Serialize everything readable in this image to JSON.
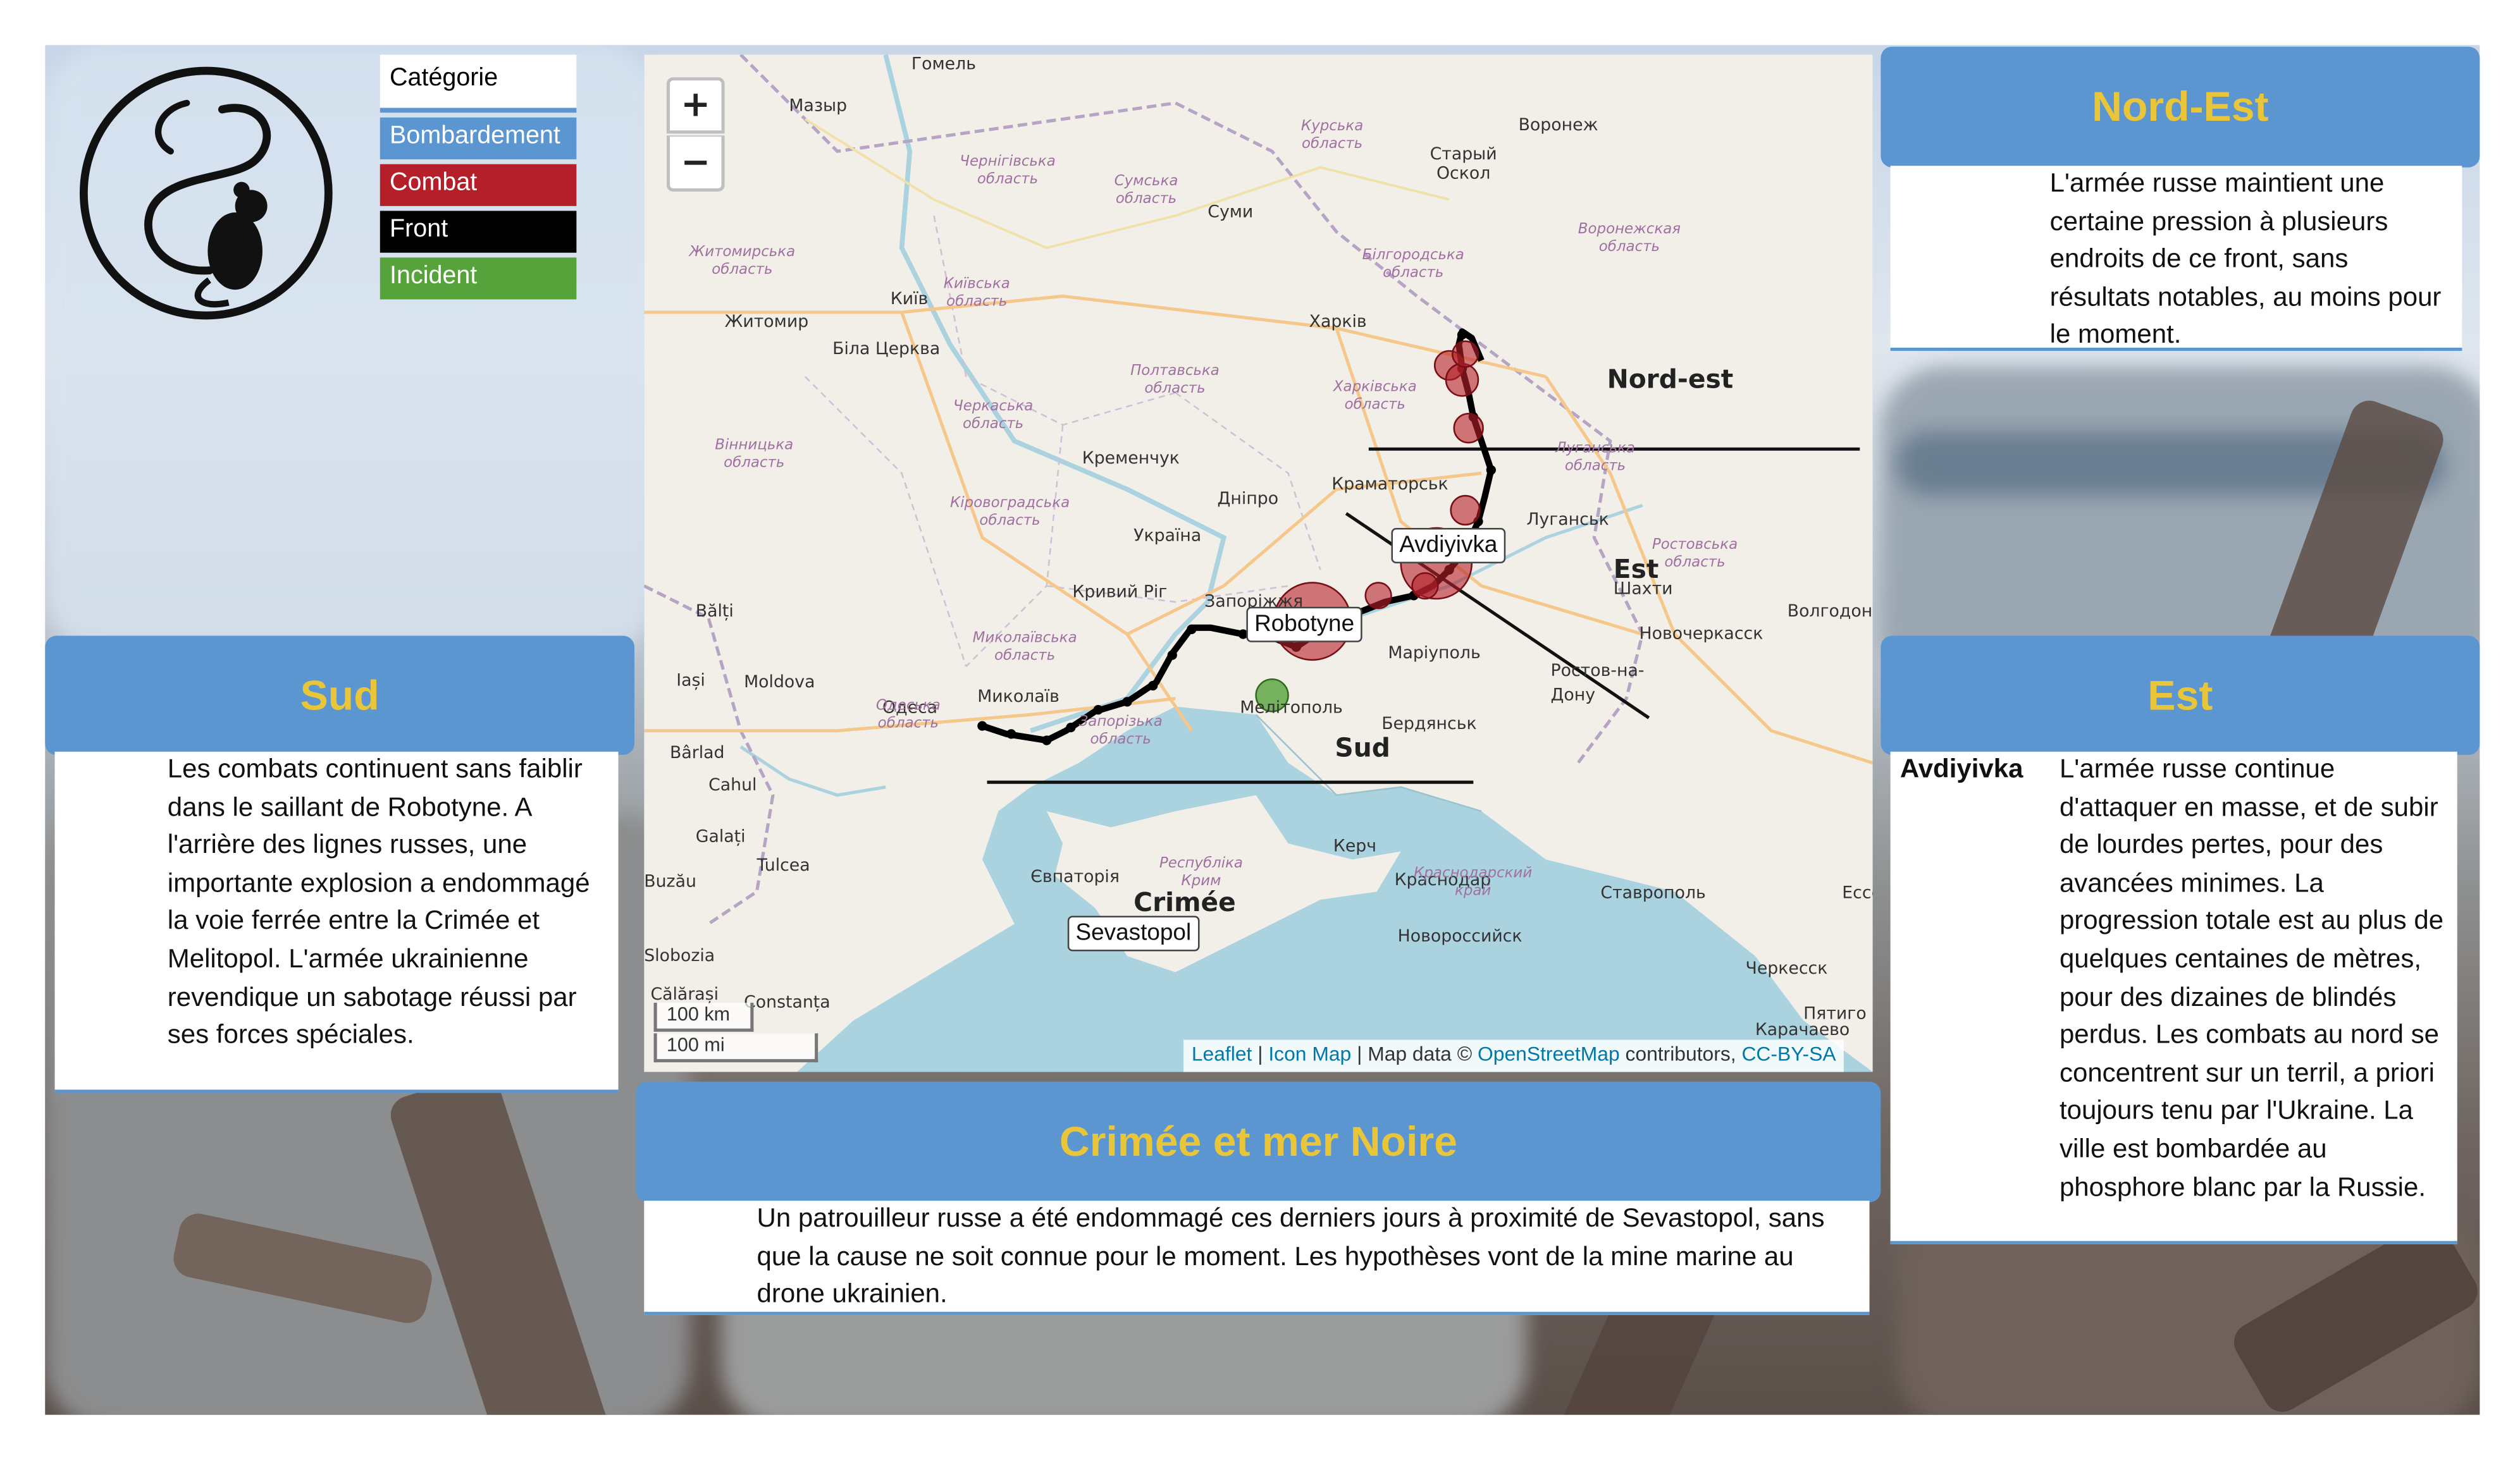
{
  "legend": {
    "title": "Catégorie",
    "items": [
      {
        "label": "Bombardement",
        "color": "#5b96d0"
      },
      {
        "label": "Combat",
        "color": "#b51f2a"
      },
      {
        "label": "Front",
        "color": "#000000"
      },
      {
        "label": "Incident",
        "color": "#56a33b"
      }
    ]
  },
  "map": {
    "zoom_in": "+",
    "zoom_out": "−",
    "markers": {
      "avdiyivka": "Avdiyivka",
      "robotyne": "Robotyne",
      "sevastopol": "Sevastopol"
    },
    "regions": {
      "nord_est": "Nord-est",
      "est": "Est",
      "sud": "Sud",
      "crimee": "Crimée"
    },
    "scale_km": "100 km",
    "scale_mi": "100 mi",
    "attribution": {
      "leaflet": "Leaflet",
      "sep1": " | ",
      "iconmap": "Icon Map",
      "mapdata": " | Map data © ",
      "osm": "OpenStreetMap",
      "contrib": " contributors, ",
      "license": "CC-BY-SA"
    },
    "cities": [
      "Гомель",
      "Мазыр",
      "Воронеж",
      "Старый Оскол",
      "Суми",
      "Київ",
      "Житомир",
      "Біла Церква",
      "Харків",
      "Кременчук",
      "Дніпро",
      "Краматорськ",
      "Луганськ",
      "Україна",
      "Кривий Ріг",
      "Запоріжжя",
      "Маріуполь",
      "Шахти",
      "Новочеркасск",
      "Волгодонск",
      "Ростов-на-Дону",
      "Миколаїв",
      "Мелітополь",
      "Бердянськ",
      "Одеса",
      "Moldova",
      "Iași",
      "Bălți",
      "Bârlad",
      "Cahul",
      "Galați",
      "Tulcea",
      "Buzău",
      "Slobozia",
      "Călărași",
      "Constanța",
      "Євпаторія",
      "Керч",
      "Краснодар",
      "Ставрополь",
      "Новороссийск",
      "Черкесск",
      "Пятиго",
      "Ессен",
      "Карачаево"
    ],
    "oblasts": [
      "Чернігівська область",
      "Сумська область",
      "Курська область",
      "Воронежская область",
      "Білгородська область",
      "Житомирська область",
      "Київська область",
      "Полтавська область",
      "Харківська область",
      "Луганська область",
      "Черкаська область",
      "Вінницька область",
      "Кіровоградська область",
      "Ростовська область",
      "Миколаївська область",
      "Одеська область",
      "Запорізька область",
      "Республіка Крим",
      "Краснодарский край"
    ]
  },
  "panels": {
    "nord_est": {
      "title": "Nord-Est",
      "text": "L'armée russe maintient une certaine pression à plusieurs endroits de ce front, sans résultats notables, au moins pour le moment."
    },
    "sud": {
      "title": "Sud",
      "text": "Les combats continuent sans faiblir dans le saillant de Robotyne. A l'arrière des lignes russes, une importante explosion a endommagé la voie ferrée entre la Crimée et Melitopol. L'armée ukrainienne revendique un sabotage réussi par ses forces spéciales."
    },
    "est": {
      "title": "Est",
      "place": "Avdiyivka",
      "text": "L'armée russe continue d'attaquer en masse, et de subir de lourdes pertes, pour des avancées minimes. La progression totale est au plus de quelques centaines de mètres, pour des dizaines de blindés perdus. Les combats au nord se concentrent sur un terril, a priori toujours tenu par l'Ukraine. La ville est bombardée au phosphore blanc par la Russie."
    },
    "crimee": {
      "title": "Crimée et mer Noire",
      "text": "Un patrouilleur russe a été endommagé ces derniers jours à proximité de Sevastopol, sans que la cause ne soit connue pour le moment. Les hypothèses vont de la mine marine au drone ukrainien."
    }
  },
  "colors": {
    "panel_header": "#5b96d0",
    "panel_title": "#e9c53a",
    "combat_marker": "#b51f2a",
    "incident_marker": "#56a33b",
    "front_line": "#000000"
  }
}
